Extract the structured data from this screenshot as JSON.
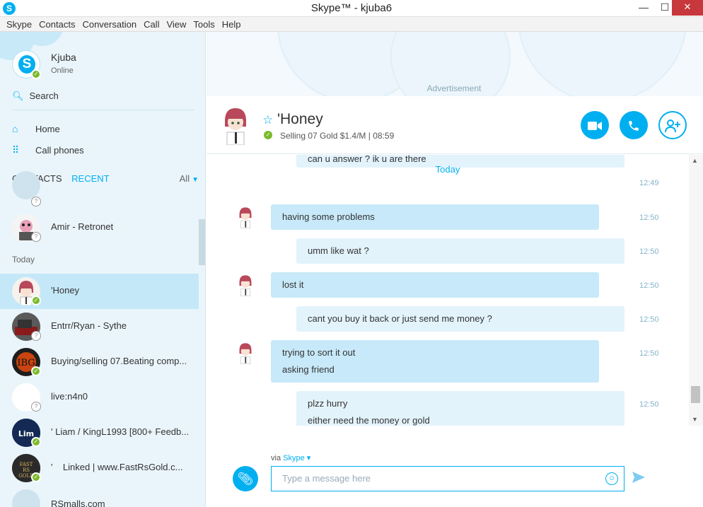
{
  "window": {
    "title": "Skype™ - kjuba6",
    "app_icon": "S",
    "min": "—",
    "max": "☐",
    "close": "✕"
  },
  "menu": [
    "Skype",
    "Contacts",
    "Conversation",
    "Call",
    "View",
    "Tools",
    "Help"
  ],
  "profile": {
    "name": "Kjuba",
    "status": "Online"
  },
  "search": {
    "label": "Search"
  },
  "nav": [
    {
      "label": "Home",
      "icon": "home-icon"
    },
    {
      "label": "Call phones",
      "icon": "dialpad-icon"
    }
  ],
  "tabs": {
    "contacts": "CONTACTS",
    "recent": "RECENT",
    "filter": "All"
  },
  "sections": {
    "today": "Today"
  },
  "contacts": [
    {
      "name": "Amir - Retronet",
      "status": "unknown"
    },
    {
      "name": "'Honey",
      "status": "online",
      "selected": true
    },
    {
      "name": "Entrr/Ryan - Sythe",
      "status": "unknown"
    },
    {
      "name": "Buying/selling 07.Beating comp...",
      "status": "online"
    },
    {
      "name": "live:n4n0",
      "status": "unknown"
    },
    {
      "name": "' Liam / KingL1993 [800+ Feedb...",
      "status": "online"
    },
    {
      "name": "'    Linked | www.FastRsGold.c...",
      "status": "online"
    },
    {
      "name": "RSmalls.com",
      "status": "unknown"
    }
  ],
  "ad": {
    "label": "Advertisement"
  },
  "conversation": {
    "name": "'Honey",
    "mood": "Selling 07 Gold $1.4/M",
    "local_time": "08:59",
    "separator": "|"
  },
  "chat": {
    "day": "Today",
    "partial_top_text": "can u answer ? ik u are there",
    "partial_top_time": "12:49",
    "messages": [
      {
        "dir": "in",
        "lines": [
          "having some problems"
        ],
        "time": "12:50"
      },
      {
        "dir": "out",
        "lines": [
          "umm like wat ?"
        ],
        "time": "12:50"
      },
      {
        "dir": "in",
        "lines": [
          "lost it"
        ],
        "time": "12:50"
      },
      {
        "dir": "out",
        "lines": [
          "cant you buy it back or just send me money ?"
        ],
        "time": "12:50"
      },
      {
        "dir": "in",
        "lines": [
          "trying to sort it out",
          "asking friend"
        ],
        "time": "12:50"
      },
      {
        "dir": "out",
        "lines": [
          "plzz hurry",
          "either need the money or gold"
        ],
        "time": "12:50"
      }
    ]
  },
  "compose": {
    "via": "via",
    "via_service": "Skype",
    "placeholder": "Type a message here"
  },
  "colors": {
    "accent": "#00aff0",
    "online": "#7cba2e",
    "selected": "#c5e8f8",
    "incoming_bubble": "#c7e9f9",
    "outgoing_bubble": "#e3f3fc"
  }
}
